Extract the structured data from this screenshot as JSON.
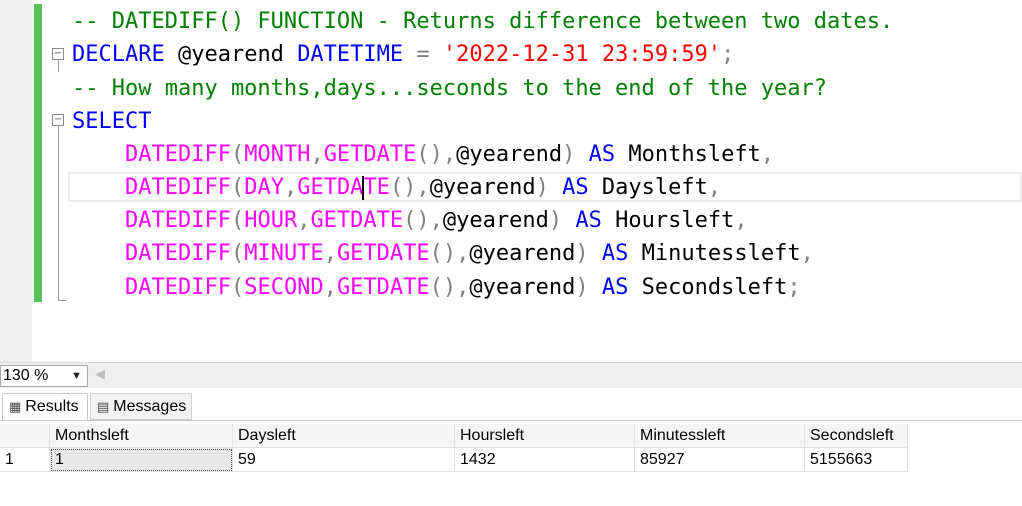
{
  "editor": {
    "lines": [
      [
        {
          "c": "cm",
          "t": "-- DATEDIFF() FUNCTION - Returns difference between two dates."
        }
      ],
      [
        {
          "c": "kw",
          "t": "DECLARE "
        },
        {
          "c": "id",
          "t": "@yearend "
        },
        {
          "c": "kw",
          "t": "DATETIME "
        },
        {
          "c": "op",
          "t": "= "
        },
        {
          "c": "st",
          "t": "'2022-12-31 23:59:59'"
        },
        {
          "c": "op",
          "t": ";"
        }
      ],
      [
        {
          "c": "cm",
          "t": "-- How many months,days...seconds to the end of the year?"
        }
      ],
      [
        {
          "c": "kw",
          "t": "SELECT"
        }
      ],
      [
        {
          "c": "id",
          "t": "    "
        },
        {
          "c": "fn",
          "t": "DATEDIFF"
        },
        {
          "c": "op",
          "t": "("
        },
        {
          "c": "fn",
          "t": "MONTH"
        },
        {
          "c": "op",
          "t": ","
        },
        {
          "c": "fn",
          "t": "GETDATE"
        },
        {
          "c": "op",
          "t": "(),"
        },
        {
          "c": "id",
          "t": "@yearend"
        },
        {
          "c": "op",
          "t": ") "
        },
        {
          "c": "kw",
          "t": "AS "
        },
        {
          "c": "id",
          "t": "Monthsleft"
        },
        {
          "c": "op",
          "t": ","
        }
      ],
      [
        {
          "c": "id",
          "t": "    "
        },
        {
          "c": "fn",
          "t": "DATEDIFF"
        },
        {
          "c": "op",
          "t": "("
        },
        {
          "c": "fn",
          "t": "DAY"
        },
        {
          "c": "op",
          "t": ","
        },
        {
          "c": "fn",
          "t": "GETDA"
        },
        {
          "c": "caret",
          "t": ""
        },
        {
          "c": "fn",
          "t": "TE"
        },
        {
          "c": "op",
          "t": "(),"
        },
        {
          "c": "id",
          "t": "@yearend"
        },
        {
          "c": "op",
          "t": ") "
        },
        {
          "c": "kw",
          "t": "AS "
        },
        {
          "c": "id",
          "t": "Daysleft"
        },
        {
          "c": "op",
          "t": ","
        }
      ],
      [
        {
          "c": "id",
          "t": "    "
        },
        {
          "c": "fn",
          "t": "DATEDIFF"
        },
        {
          "c": "op",
          "t": "("
        },
        {
          "c": "fn",
          "t": "HOUR"
        },
        {
          "c": "op",
          "t": ","
        },
        {
          "c": "fn",
          "t": "GETDATE"
        },
        {
          "c": "op",
          "t": "(),"
        },
        {
          "c": "id",
          "t": "@yearend"
        },
        {
          "c": "op",
          "t": ") "
        },
        {
          "c": "kw",
          "t": "AS "
        },
        {
          "c": "id",
          "t": "Hoursleft"
        },
        {
          "c": "op",
          "t": ","
        }
      ],
      [
        {
          "c": "id",
          "t": "    "
        },
        {
          "c": "fn",
          "t": "DATEDIFF"
        },
        {
          "c": "op",
          "t": "("
        },
        {
          "c": "fn",
          "t": "MINUTE"
        },
        {
          "c": "op",
          "t": ","
        },
        {
          "c": "fn",
          "t": "GETDATE"
        },
        {
          "c": "op",
          "t": "(),"
        },
        {
          "c": "id",
          "t": "@yearend"
        },
        {
          "c": "op",
          "t": ") "
        },
        {
          "c": "kw",
          "t": "AS "
        },
        {
          "c": "id",
          "t": "Minutessleft"
        },
        {
          "c": "op",
          "t": ","
        }
      ],
      [
        {
          "c": "id",
          "t": "    "
        },
        {
          "c": "fn",
          "t": "DATEDIFF"
        },
        {
          "c": "op",
          "t": "("
        },
        {
          "c": "fn",
          "t": "SECOND"
        },
        {
          "c": "op",
          "t": ","
        },
        {
          "c": "fn",
          "t": "GETDATE"
        },
        {
          "c": "op",
          "t": "(),"
        },
        {
          "c": "id",
          "t": "@yearend"
        },
        {
          "c": "op",
          "t": ") "
        },
        {
          "c": "kw",
          "t": "AS "
        },
        {
          "c": "id",
          "t": "Secondsleft"
        },
        {
          "c": "op",
          "t": ";"
        }
      ]
    ]
  },
  "zoom": {
    "value": "130 %"
  },
  "tabs": {
    "results": "Results",
    "messages": "Messages",
    "results_icon": "grid-icon",
    "messages_icon": "messages-icon"
  },
  "grid": {
    "columns": [
      "Monthsleft",
      "Daysleft",
      "Hoursleft",
      "Minutessleft",
      "Secondsleft"
    ],
    "rows": [
      {
        "num": "1",
        "cells": [
          "1",
          "59",
          "1432",
          "85927",
          "5155663"
        ]
      }
    ]
  },
  "colors": {
    "comment": "#008000",
    "keyword": "#0000ff",
    "function": "#ff00ff",
    "string": "#ff0000",
    "operator": "#808080",
    "change_bar": "#57c15a"
  }
}
